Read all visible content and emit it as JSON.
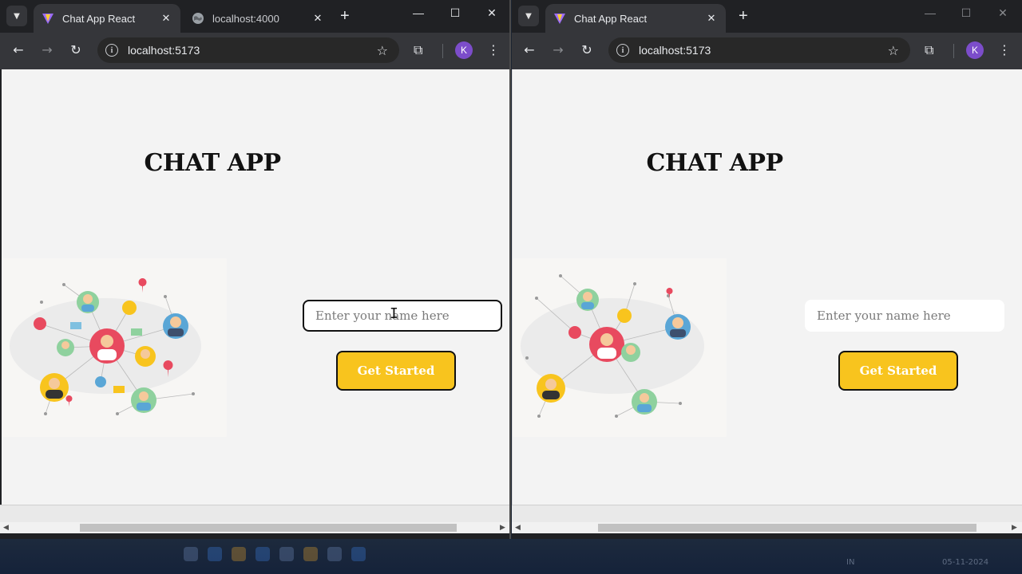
{
  "windows": [
    {
      "id": "left",
      "tabs": [
        {
          "title": "Chat App React",
          "active": true
        },
        {
          "title": "localhost:4000",
          "active": false
        }
      ],
      "url": "localhost:5173",
      "profile_initial": "K",
      "page": {
        "title": "CHAT APP",
        "input_placeholder": "Enter your name here",
        "button_label": "Get Started"
      }
    },
    {
      "id": "right",
      "tabs": [
        {
          "title": "Chat App React",
          "active": true
        }
      ],
      "url": "localhost:5173",
      "profile_initial": "K",
      "page": {
        "title": "CHAT APP",
        "input_placeholder": "Enter your name here",
        "button_label": "Get Started"
      }
    }
  ],
  "taskbar": {
    "lang": "IN",
    "date": "05-11-2024"
  },
  "colors": {
    "accent_button": "#f8c41e",
    "page_bg": "#f3f3f3",
    "chrome_dark": "#202124",
    "avatar": "#7c4dca"
  },
  "icons": [
    "vite-icon",
    "globe-icon",
    "info-icon",
    "star-icon",
    "extensions-icon",
    "kebab-icon",
    "back-icon",
    "forward-icon",
    "reload-icon"
  ]
}
